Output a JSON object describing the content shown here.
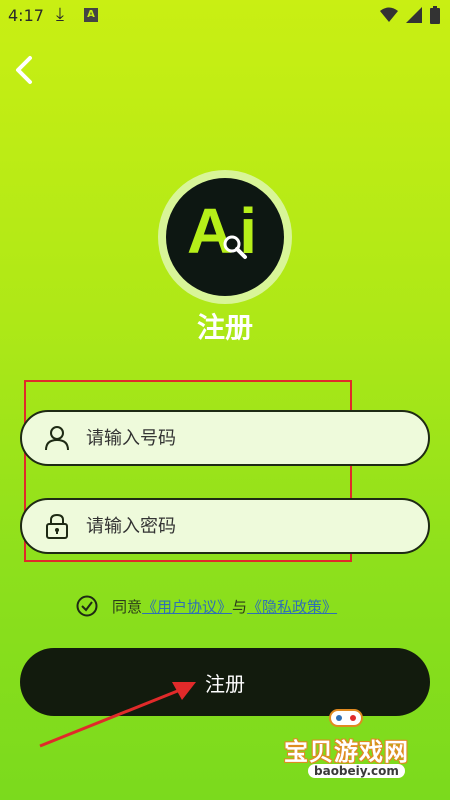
{
  "status_bar": {
    "time": "4:17"
  },
  "header": {
    "back_icon": "chevron-left-icon"
  },
  "logo": {
    "text": "Ai",
    "icon": "magnifier-icon"
  },
  "title": "注册",
  "form": {
    "phone_placeholder": "请输入号码",
    "password_placeholder": "请输入密码",
    "phone_icon": "user-icon",
    "password_icon": "lock-icon"
  },
  "agreement": {
    "prefix": "同意",
    "user_agreement": "《用户协议》",
    "conjunction": "与",
    "privacy_policy": "《隐私政策》"
  },
  "submit_label": "注册",
  "watermark": {
    "name": "宝贝游戏网",
    "url": "baobeiy.com"
  },
  "colors": {
    "accent": "#b6ef19",
    "button_bg": "#121b0d",
    "annotation": "#e02a2a"
  }
}
